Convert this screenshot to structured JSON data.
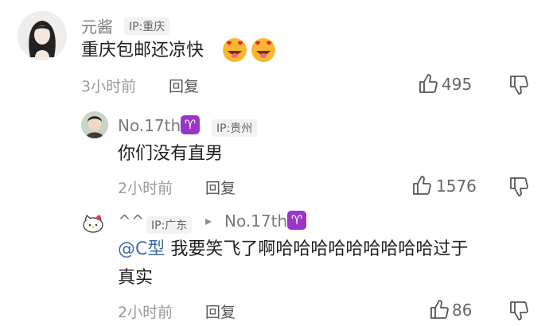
{
  "comments": [
    {
      "username": "元酱",
      "ip": "IP:重庆",
      "text": "重庆包邮还凉快",
      "emojis": [
        "heart-eyes-tongue-emoji",
        "heart-eyes-tongue-emoji"
      ],
      "time": "3小时前",
      "reply_label": "回复",
      "likes": "495"
    },
    {
      "username": "No.17th",
      "badge": "♈",
      "ip": "IP:贵州",
      "text": "你们没有直男",
      "time": "2小时前",
      "reply_label": "回复",
      "likes": "1576"
    },
    {
      "username": "^^",
      "ip": "IP:广东",
      "reply_to_arrow": "▸",
      "reply_to": "No.17th",
      "reply_to_badge": "♈",
      "mention": "@C型",
      "text_line1": "我要笑飞了啊哈哈哈哈哈哈哈哈哈过于",
      "text_line2": "真实",
      "time": "2小时前",
      "reply_label": "回复",
      "likes": "86"
    }
  ],
  "colors": {
    "badge": "#9b34c8",
    "mention": "#3f6ea8",
    "meta": "#9a9a9a"
  },
  "icons": {
    "like": "thumbs-up-icon",
    "dislike": "thumbs-down-icon"
  }
}
